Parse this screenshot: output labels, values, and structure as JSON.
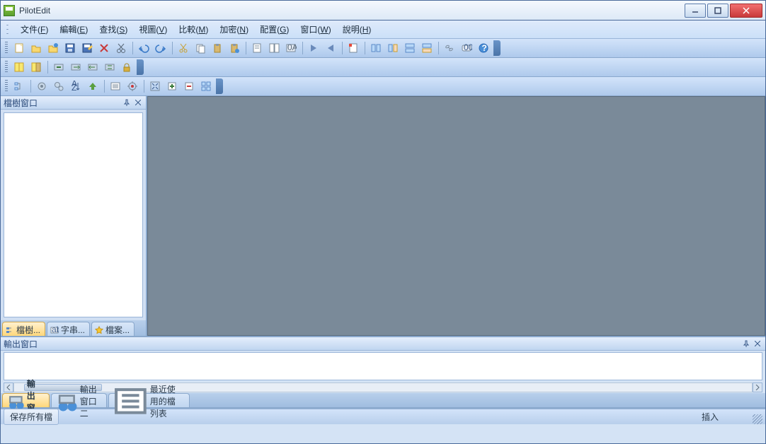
{
  "title": "PilotEdit",
  "menu": {
    "items": [
      {
        "label": "文件",
        "hotkey": "F"
      },
      {
        "label": "編輯",
        "hotkey": "E"
      },
      {
        "label": "查找",
        "hotkey": "S"
      },
      {
        "label": "視圖",
        "hotkey": "V"
      },
      {
        "label": "比較",
        "hotkey": "M"
      },
      {
        "label": "加密",
        "hotkey": "N"
      },
      {
        "label": "配置",
        "hotkey": "G"
      },
      {
        "label": "窗口",
        "hotkey": "W"
      },
      {
        "label": "說明",
        "hotkey": "H"
      }
    ]
  },
  "left_pane": {
    "title": "檔樹窗口",
    "tabs": [
      {
        "label": "檔樹...",
        "active": true,
        "icon": "tree"
      },
      {
        "label": "字串...",
        "active": false,
        "icon": "string"
      },
      {
        "label": "檔案...",
        "active": false,
        "icon": "fav"
      }
    ]
  },
  "output_pane": {
    "title": "輸出窗口",
    "tabs": [
      {
        "label": "輸出窗口",
        "active": true,
        "icon": "out"
      },
      {
        "label": "輸出窗口二",
        "active": false,
        "icon": "out"
      },
      {
        "label": "最近使用的檔列表",
        "active": false,
        "icon": "recent"
      }
    ]
  },
  "status": {
    "left": "保存所有檔",
    "right": "插入"
  },
  "toolbar1_icons": [
    "new",
    "open",
    "open-remote",
    "save",
    "save-as",
    "delete",
    "cut",
    "sep",
    "undo",
    "redo",
    "sep",
    "scissors",
    "copy",
    "paste",
    "paste-special",
    "sep",
    "doc1",
    "doc2",
    "hex",
    "sep",
    "next",
    "prev",
    "sep",
    "mark",
    "sep",
    "grp1",
    "grp2",
    "grp3",
    "grp4",
    "sep",
    "link",
    "counter",
    "help"
  ],
  "toolbar2_icons": [
    "cmp1",
    "cmp2",
    "sep",
    "sync1",
    "sync2",
    "sync3",
    "sync4",
    "lock"
  ],
  "toolbar3_icons": [
    "tree-refresh",
    "sep",
    "cfg1",
    "cfg2",
    "sort",
    "up",
    "sep",
    "list",
    "target",
    "sep",
    "expand",
    "plus",
    "minus",
    "tile"
  ]
}
